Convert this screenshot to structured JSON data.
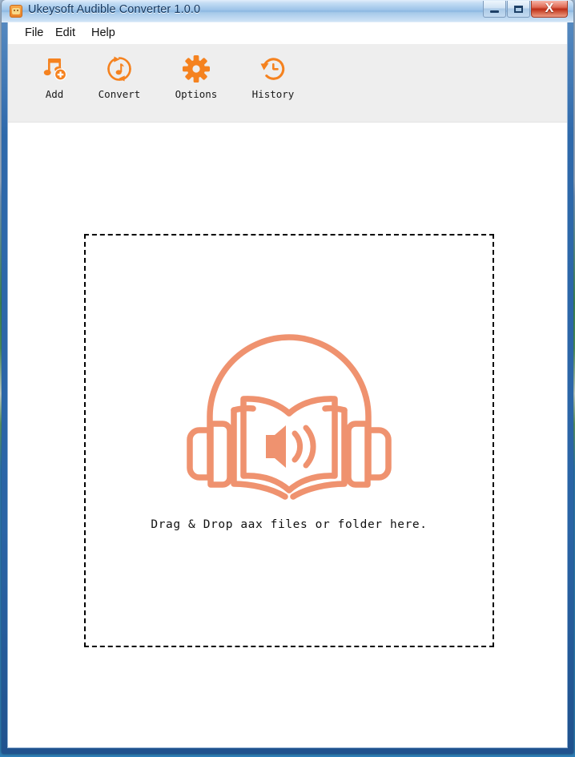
{
  "window": {
    "title": "Ukeysoft Audible Converter 1.0.0",
    "app_icon": "app-robot-icon",
    "controls": {
      "minimize": "—",
      "maximize": "□",
      "close": "X"
    }
  },
  "menu": {
    "items": [
      {
        "label": "File",
        "name": "menu-file"
      },
      {
        "label": "Edit",
        "name": "menu-edit"
      },
      {
        "label": "Help",
        "name": "menu-help"
      }
    ]
  },
  "toolbar": {
    "buttons": [
      {
        "label": "Add",
        "icon": "music-note-add-icon"
      },
      {
        "label": "Convert",
        "icon": "convert-refresh-music-icon"
      },
      {
        "label": "Options",
        "icon": "gear-icon"
      },
      {
        "label": "History",
        "icon": "clock-rewind-icon"
      }
    ]
  },
  "main": {
    "drop_zone": {
      "icon": "headphones-audiobook-icon",
      "text": "Drag & Drop aax files or folder here."
    }
  },
  "colors": {
    "accent_orange": "#F5821F",
    "icon_salmon": "#EF926F",
    "toolbar_bg": "#EEEEEE",
    "title_text": "#12365E",
    "close_button": "#BB2D17",
    "frame_blue": "#2E69AB"
  }
}
